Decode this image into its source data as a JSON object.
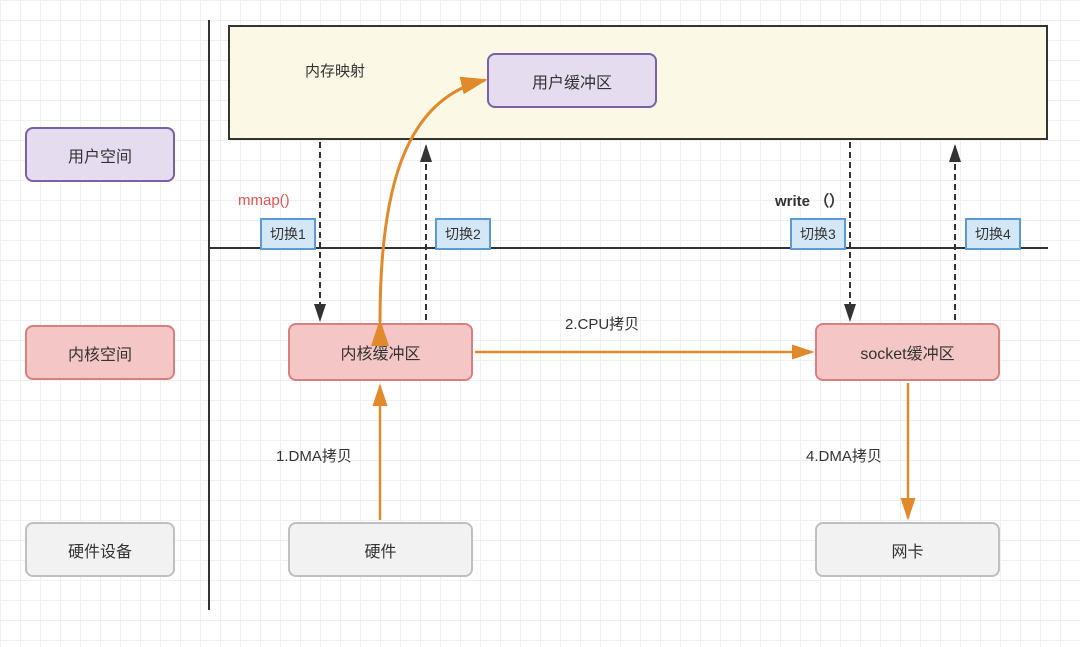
{
  "rows": {
    "user_space": "用户空间",
    "kernel_space": "内核空间",
    "hardware": "硬件设备"
  },
  "boxes": {
    "user_buffer": "用户缓冲区",
    "kernel_buffer": "内核缓冲区",
    "socket_buffer": "socket缓冲区",
    "hardware_box": "硬件",
    "nic_box": "网卡"
  },
  "labels": {
    "mmap_title": "内存映射",
    "mmap_call": "mmap()",
    "write_call": "write （）",
    "dma_copy_1": "1.DMA拷贝",
    "cpu_copy_2": "2.CPU拷贝",
    "dma_copy_4": "4.DMA拷贝",
    "switch1": "切换1",
    "switch2": "切换2",
    "switch3": "切换3",
    "switch4": "切换4"
  },
  "colors": {
    "orange": "#e08a2c",
    "dashed": "#333333"
  }
}
